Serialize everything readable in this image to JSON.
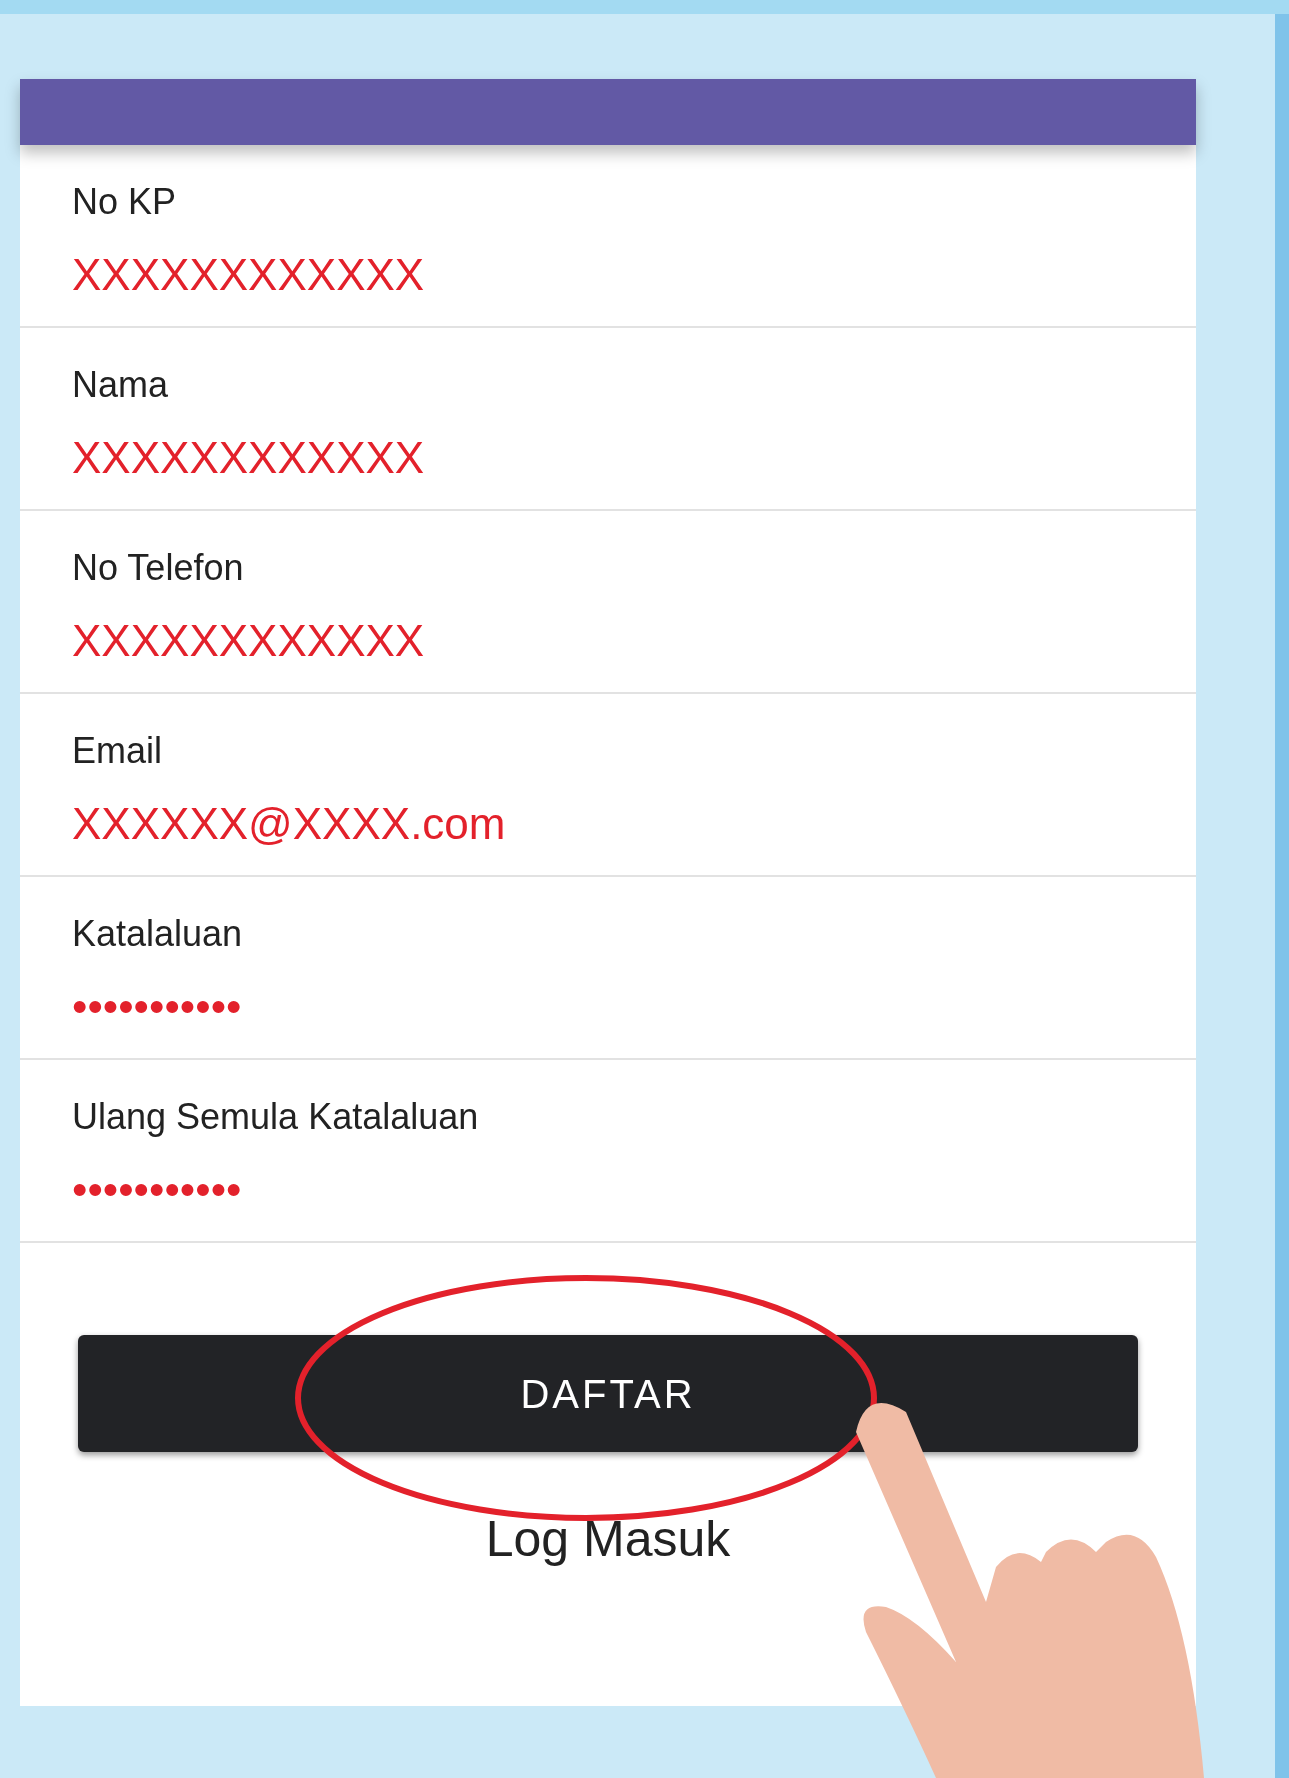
{
  "form": {
    "fields": [
      {
        "label": "No KP",
        "value": "XXXXXXXXXXXX"
      },
      {
        "label": "Nama",
        "value": "XXXXXXXXXXXX"
      },
      {
        "label": "No Telefon",
        "value": "XXXXXXXXXXXX"
      },
      {
        "label": "Email",
        "value": "XXXXXX@XXXX.com"
      },
      {
        "label": "Katalaluan",
        "value": "•••••••••••"
      },
      {
        "label": "Ulang Semula Katalaluan",
        "value": "•••••••••••"
      }
    ],
    "submit_button": "DAFTAR",
    "login_link": "Log Masuk"
  }
}
